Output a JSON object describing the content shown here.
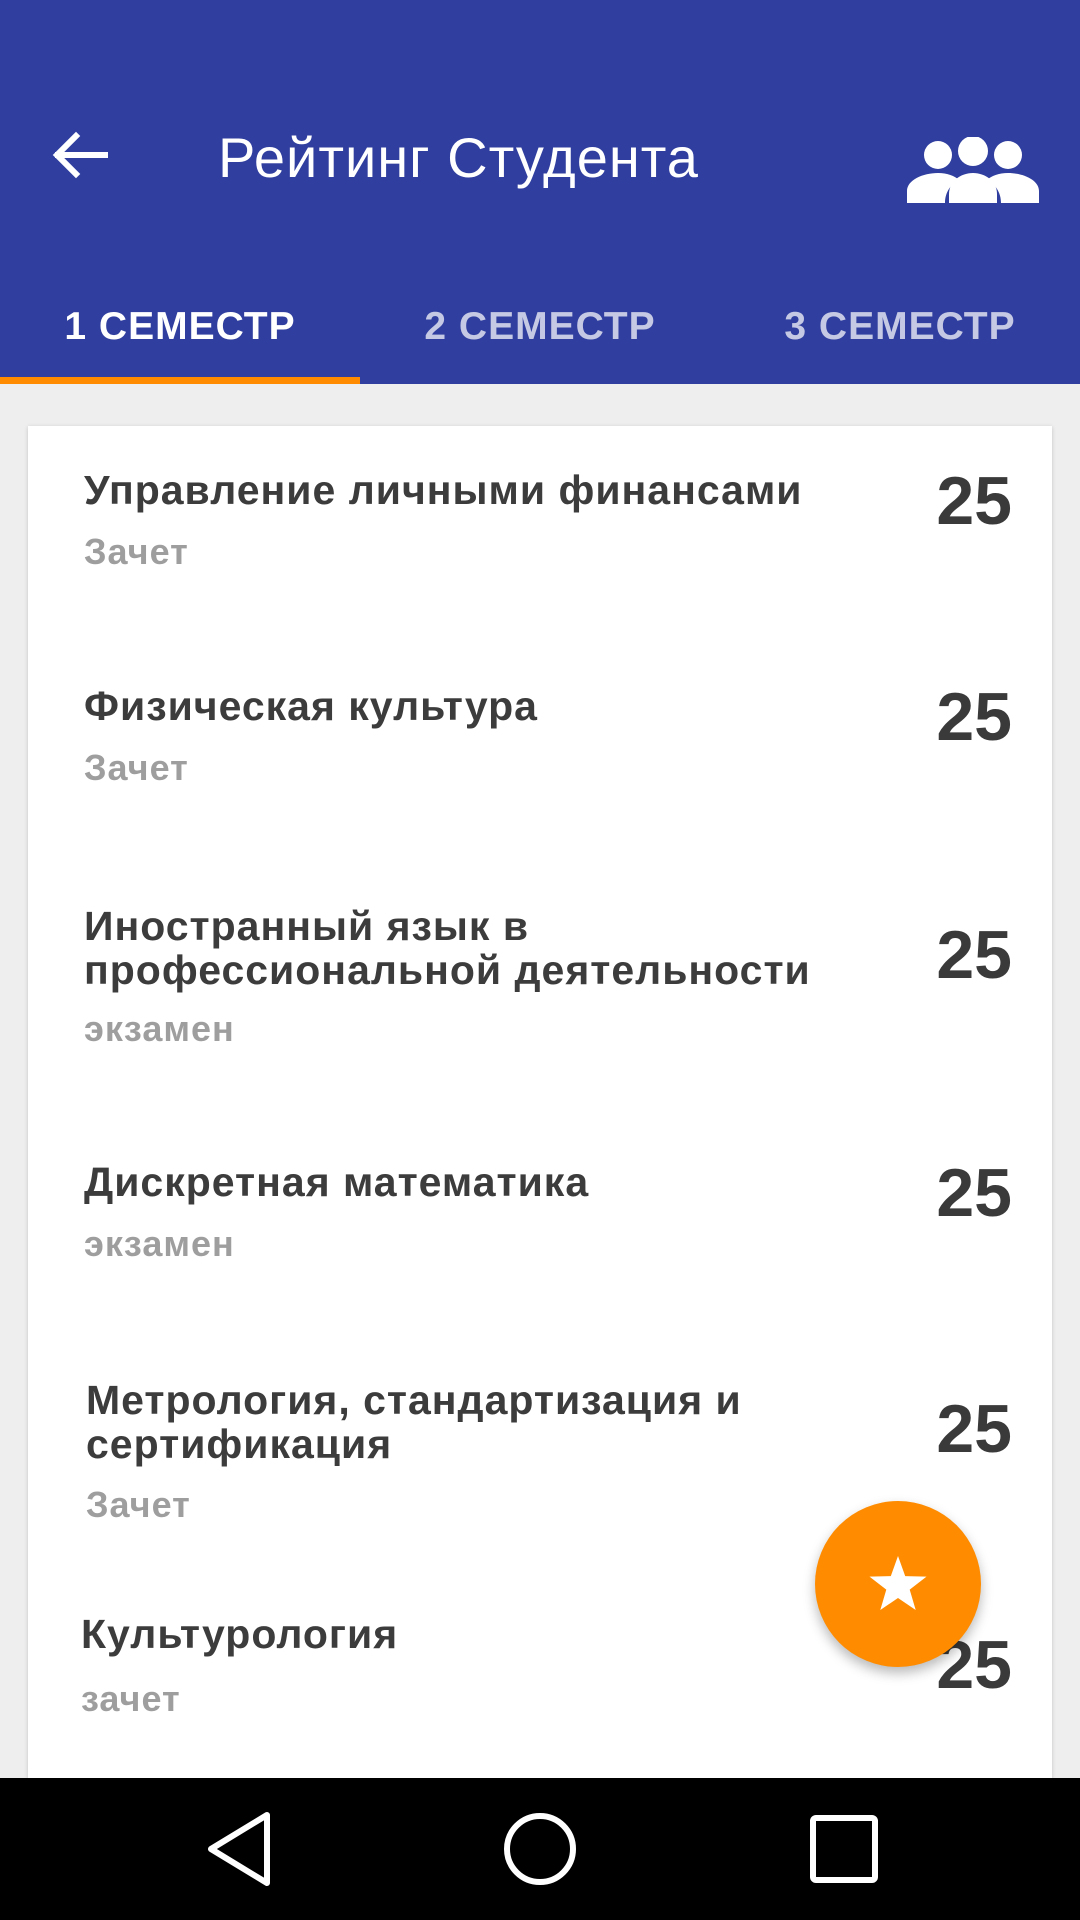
{
  "app_bar": {
    "title": "Рейтинг Студента",
    "back_icon": "arrow-left-icon",
    "group_icon": "people-icon",
    "background": "#303f9f"
  },
  "tabs": [
    {
      "label": "1 СЕМЕСТР",
      "active": true
    },
    {
      "label": "2 СЕМЕСТР",
      "active": false
    },
    {
      "label": "3 СЕМЕСТР",
      "active": false
    }
  ],
  "accent_color": "#ff8c00",
  "subjects": [
    {
      "name": "Управление личными финансами",
      "type": "Зачет",
      "score": "25"
    },
    {
      "name": "Физическая культура",
      "type": "Зачет",
      "score": "25"
    },
    {
      "name": "Иностранный язык в профессиональной деятельности",
      "type": "экзамен",
      "score": "25"
    },
    {
      "name": "Дискретная математика",
      "type": "экзамен",
      "score": "25"
    },
    {
      "name": "Метрология, стандартизация и сертификация",
      "type": "Зачет",
      "score": "25"
    },
    {
      "name": "Культурология",
      "type": "зачет",
      "score": "25"
    }
  ],
  "fab": {
    "icon": "star-icon"
  },
  "nav_bar": {
    "back_icon": "triangle-back-icon",
    "home_icon": "circle-home-icon",
    "recents_icon": "square-recents-icon"
  }
}
